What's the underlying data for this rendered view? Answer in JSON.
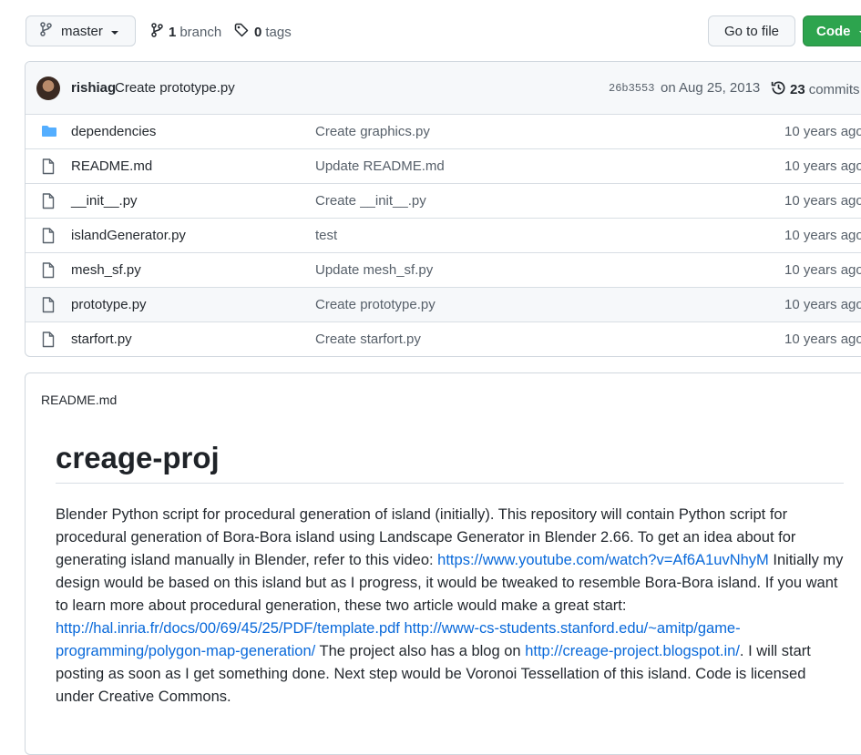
{
  "toolbar": {
    "branch_label": "master",
    "branches_count": "1",
    "branches_label": "branch",
    "tags_count": "0",
    "tags_label": "tags",
    "go_to_file_label": "Go to file",
    "code_label": "Code"
  },
  "latest_commit": {
    "author": "rishiag",
    "message": "Create prototype.py",
    "sha": "26b3553",
    "date": "on Aug 25, 2013",
    "commits_count": "23",
    "commits_label": "commits"
  },
  "files": [
    {
      "name": "dependencies",
      "type": "folder",
      "message": "Create graphics.py",
      "age": "10 years ago"
    },
    {
      "name": "README.md",
      "type": "file",
      "message": "Update README.md",
      "age": "10 years ago"
    },
    {
      "name": "__init__.py",
      "type": "file",
      "message": "Create __init__.py",
      "age": "10 years ago"
    },
    {
      "name": "islandGenerator.py",
      "type": "file",
      "message": "test",
      "age": "10 years ago"
    },
    {
      "name": "mesh_sf.py",
      "type": "file",
      "message": "Update mesh_sf.py",
      "age": "10 years ago"
    },
    {
      "name": "prototype.py",
      "type": "file",
      "message": "Create prototype.py",
      "age": "10 years ago"
    },
    {
      "name": "starfort.py",
      "type": "file",
      "message": "Create starfort.py",
      "age": "10 years ago"
    }
  ],
  "readme": {
    "filename": "README.md",
    "title": "creage-proj",
    "text_1": "Blender Python script for procedural generation of island (initially). This repository will contain Python script for procedural generation of Bora-Bora island using Landscape Generator in Blender 2.66. To get an idea about for generating island manually in Blender, refer to this video: ",
    "link_1": "https://www.youtube.com/watch?v=Af6A1uvNhyM",
    "text_2": " Initially my design would be based on this island but as I progress, it would be tweaked to resemble Bora-Bora island. If you want to learn more about procedural generation, these two article would make a great start: ",
    "link_2": "http://hal.inria.fr/docs/00/69/45/25/PDF/template.pdf",
    "text_3": " ",
    "link_3": "http://www-cs-students.stanford.edu/~amitp/game-programming/polygon-map-generation/",
    "text_4": " The project also has a blog on ",
    "link_4": "http://creage-project.blogspot.in/",
    "text_5": ". I will start posting as soon as I get something done. Next step would be Voronoi Tessellation of this island. Code is licensed under Creative Commons."
  },
  "colors": {
    "accent_green": "#2da44e",
    "link_blue": "#0969da",
    "folder_blue": "#54aeff"
  },
  "icons": [
    "branch-icon",
    "tag-icon",
    "caret-down-icon",
    "history-icon",
    "folder-icon",
    "file-icon"
  ]
}
